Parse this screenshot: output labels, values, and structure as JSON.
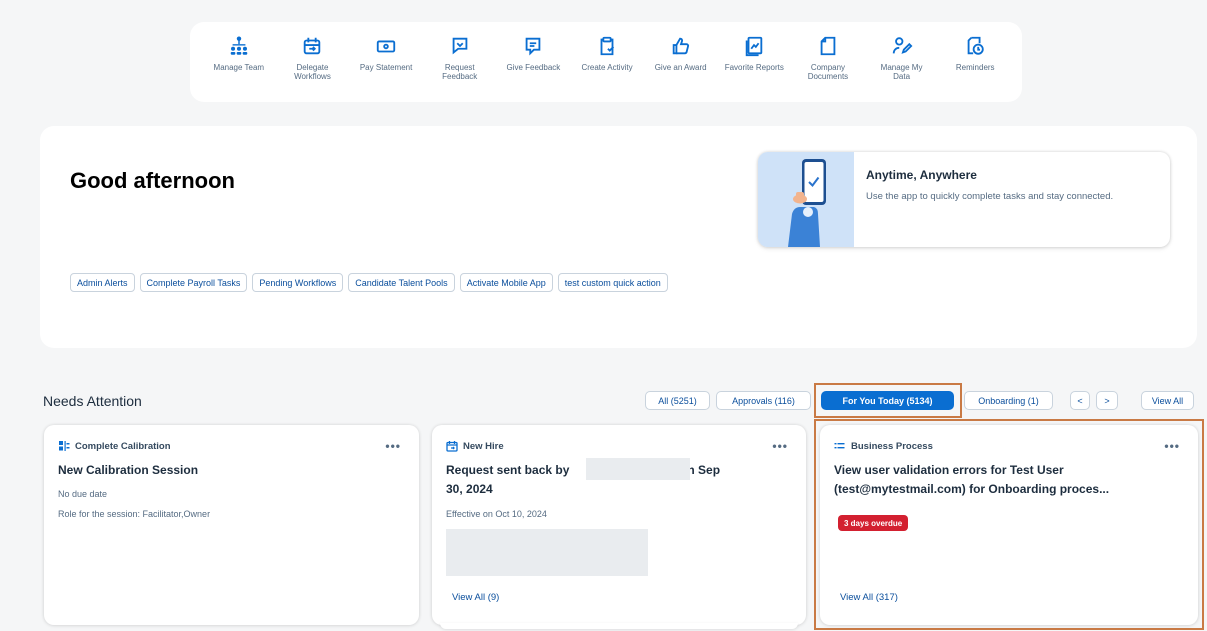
{
  "shortcuts": [
    {
      "label": "Manage Team",
      "icon": "org-chart-icon"
    },
    {
      "label": "Delegate Workflows",
      "icon": "delegate-icon"
    },
    {
      "label": "Pay Statement",
      "icon": "money-icon"
    },
    {
      "label": "Request Feedback",
      "icon": "request-feedback-icon"
    },
    {
      "label": "Give Feedback",
      "icon": "feedback-icon"
    },
    {
      "label": "Create Activity",
      "icon": "clipboard-icon"
    },
    {
      "label": "Give an Award",
      "icon": "thumbs-up-icon"
    },
    {
      "label": "Favorite Reports",
      "icon": "reports-icon"
    },
    {
      "label": "Company Documents",
      "icon": "document-icon"
    },
    {
      "label": "Manage My Data",
      "icon": "user-edit-icon"
    },
    {
      "label": "Reminders",
      "icon": "reminder-icon"
    }
  ],
  "greeting": {
    "title": "Good afternoon",
    "promo": {
      "title": "Anytime, Anywhere",
      "description": "Use the app to quickly complete tasks and stay connected."
    },
    "quick_actions": [
      "Admin Alerts",
      "Complete Payroll Tasks",
      "Pending Workflows",
      "Candidate Talent Pools",
      "Activate Mobile App",
      "test custom quick action"
    ]
  },
  "needs_attention": {
    "title": "Needs Attention",
    "filters": {
      "all": "All (5251)",
      "approvals": "Approvals (116)",
      "for_you_today": "For You Today (5134)",
      "onboarding": "Onboarding (1)",
      "prev": "<",
      "next": ">",
      "view_all": "View All"
    },
    "cards": [
      {
        "category": "Complete Calibration",
        "icon": "calibration-icon",
        "more": "•••",
        "title": "New Calibration Session",
        "line1": "No due date",
        "line2": "Role for the session: Facilitator,Owner"
      },
      {
        "category": "New Hire",
        "icon": "new-hire-icon",
        "more": "•••",
        "title_part1": "Request sent back by",
        "title_part2": "on Sep",
        "title_part3": "30, 2024",
        "effective": "Effective on Oct 10, 2024",
        "view_all": "View All (9)"
      },
      {
        "category": "Business Process",
        "icon": "process-icon",
        "more": "•••",
        "title_line1": "View user validation errors for Test User",
        "title_line2": "(test@mytestmail.com) for Onboarding proces...",
        "badge": "3 days overdue",
        "view_all": "View All (317)"
      }
    ]
  },
  "colors": {
    "accent": "#0a6ed1",
    "highlight": "#c97a45",
    "overdue": "#d32030"
  }
}
